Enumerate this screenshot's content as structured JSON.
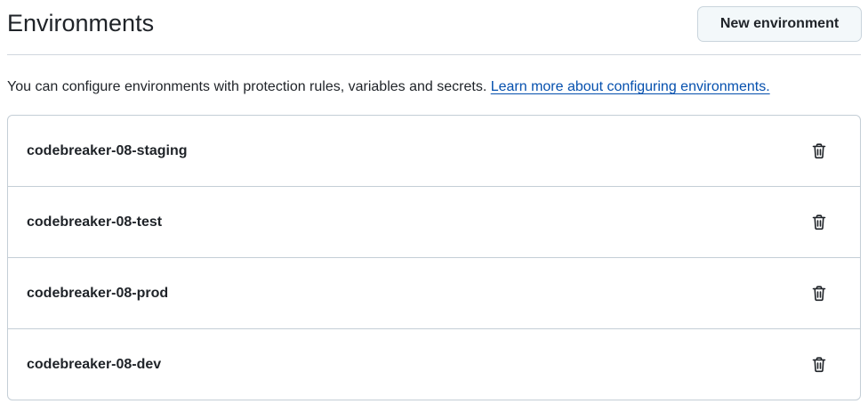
{
  "header": {
    "title": "Environments",
    "new_button_label": "New environment"
  },
  "description": {
    "text": "You can configure environments with protection rules, variables and secrets. ",
    "link_text": "Learn more about configuring environments."
  },
  "environments": [
    {
      "name": "codebreaker-08-staging",
      "action_icon": "trash-icon"
    },
    {
      "name": "codebreaker-08-test",
      "action_icon": "trash-icon"
    },
    {
      "name": "codebreaker-08-prod",
      "action_icon": "trash-icon"
    },
    {
      "name": "codebreaker-08-dev",
      "action_icon": "trash-icon"
    }
  ],
  "colors": {
    "link": "#0550ae",
    "text": "#1f2328",
    "border": "#c4ced6",
    "button_bg": "#f3f8fa"
  }
}
